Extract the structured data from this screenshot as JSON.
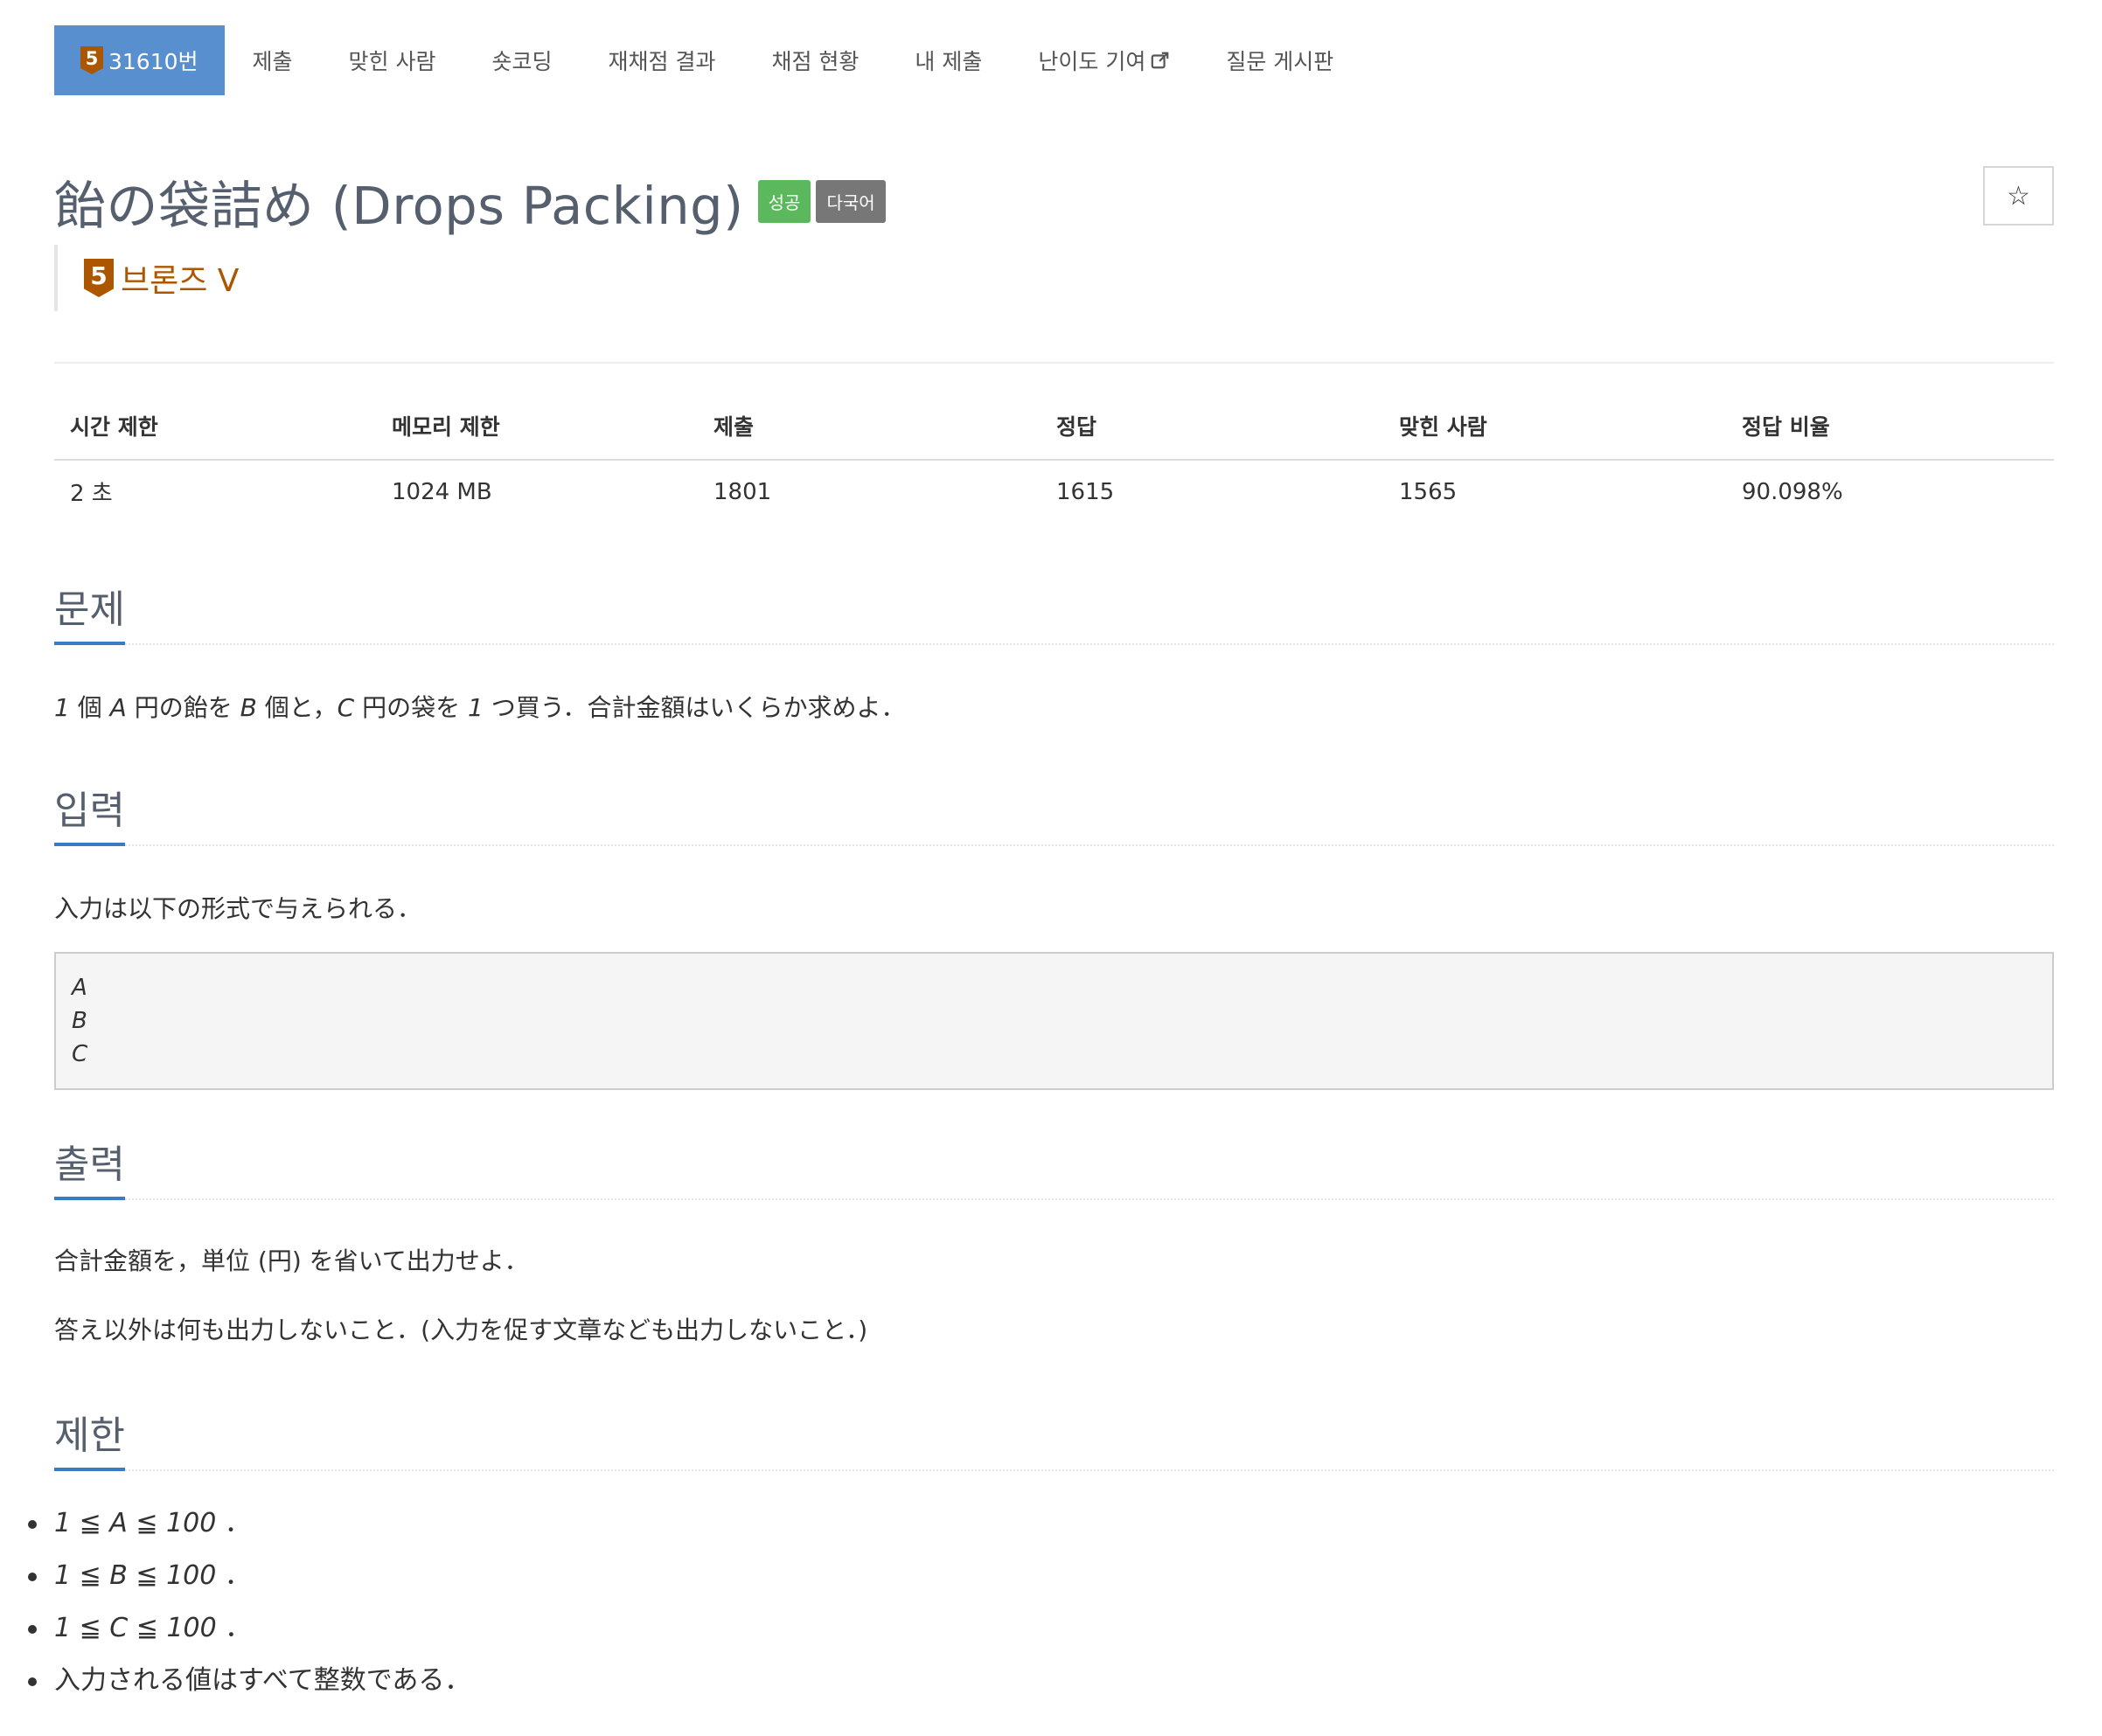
{
  "nav": {
    "tabs": [
      {
        "label": "31610번",
        "tier": "5"
      },
      {
        "label": "제출"
      },
      {
        "label": "맞힌 사람"
      },
      {
        "label": "숏코딩"
      },
      {
        "label": "재채점 결과"
      },
      {
        "label": "채점 현황"
      },
      {
        "label": "내 제출"
      },
      {
        "label": "난이도 기여"
      },
      {
        "label": "질문 게시판"
      }
    ]
  },
  "problem": {
    "title": "飴の袋詰め (Drops Packing)",
    "badge_success": "성공",
    "badge_multilang": "다국어",
    "tier_number": "5",
    "tier_name": "브론즈 V",
    "star": "☆"
  },
  "info_table": {
    "headers": [
      "시간 제한",
      "메모리 제한",
      "제출",
      "정답",
      "맞힌 사람",
      "정답 비율"
    ],
    "values": [
      "2 초",
      "1024 MB",
      "1801",
      "1615",
      "1565",
      "90.098%"
    ]
  },
  "sections": {
    "description": {
      "heading": "문제",
      "segments": [
        "1",
        " 個 ",
        "A",
        " 円の飴を ",
        "B",
        " 個と，",
        "C",
        " 円の袋を ",
        "1",
        " つ買う．合計金額はいくらか求めよ．"
      ]
    },
    "input": {
      "heading": "입력",
      "text": "入力は以下の形式で与えられる．",
      "format_lines": [
        "A",
        "B",
        "C"
      ]
    },
    "output": {
      "heading": "출력",
      "text1": "合計金額を，単位 (円) を省いて出力せよ．",
      "text2": "答え以外は何も出力しないこと．(入力を促す文章なども出力しないこと．)"
    },
    "limits": {
      "heading": "제한",
      "items": [
        {
          "expr": "1 ≦ A ≦ 100",
          "suffix": "．"
        },
        {
          "expr": "1 ≦ B ≦ 100",
          "suffix": "．"
        },
        {
          "expr": "1 ≦ C ≦ 100",
          "suffix": "．"
        },
        {
          "expr": "",
          "suffix": "入力される値はすべて整数である．"
        }
      ]
    }
  },
  "colors": {
    "active_tab": "#588fcf",
    "bronze": "#ad5600",
    "success": "#5cb85c",
    "multi": "#777777",
    "heading_underline": "#3b7ac4"
  }
}
